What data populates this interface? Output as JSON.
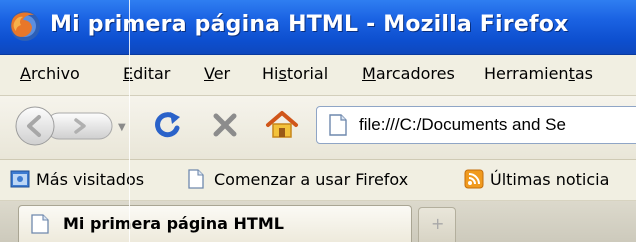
{
  "window": {
    "title": "Mi primera página HTML - Mozilla Firefox"
  },
  "menu": {
    "items": [
      {
        "pre": "",
        "key": "A",
        "post": "rchivo"
      },
      {
        "pre": "",
        "key": "E",
        "post": "ditar"
      },
      {
        "pre": "",
        "key": "V",
        "post": "er"
      },
      {
        "pre": "Hi",
        "key": "s",
        "post": "torial"
      },
      {
        "pre": "",
        "key": "M",
        "post": "arcadores"
      },
      {
        "pre": "Herramien",
        "key": "t",
        "post": "as"
      }
    ]
  },
  "navigation": {
    "url": "file:///C:/Documents and Se"
  },
  "bookmarks": {
    "items": [
      {
        "label": "Más visitados",
        "icon": "most-visited-icon"
      },
      {
        "label": "Comenzar a usar Firefox",
        "icon": "page-icon"
      },
      {
        "label": "Últimas noticia",
        "icon": "rss-feed-icon"
      }
    ]
  },
  "tabs": {
    "active_label": "Mi primera página HTML",
    "new_tab_symbol": "+"
  },
  "colors": {
    "titlebar": "#1b63e3",
    "menubar": "#f1efe2",
    "reload": "#2a62c9",
    "stop": "#8c8c8c",
    "home": "#e8a21a"
  }
}
